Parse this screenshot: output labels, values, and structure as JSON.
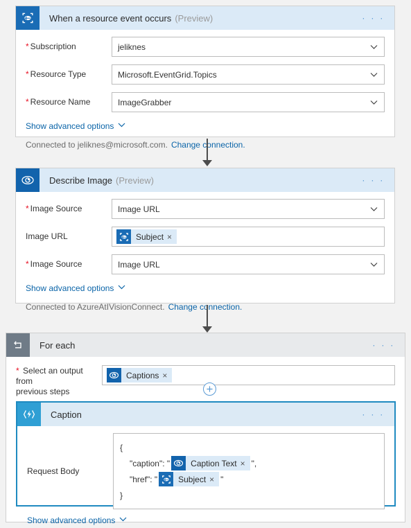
{
  "colors": {
    "accent": "#0078d4",
    "link": "#0a64a8",
    "required": "#e81123",
    "header_blue": "#dbeaf7",
    "header_gray": "#e8eaec",
    "eventgrid_icon_bg": "#1a6cb5",
    "vision_icon_bg": "#1263ac",
    "foreach_icon_bg": "#6f7b87",
    "function_icon_bg": "#2f9fd4",
    "canvas": "#f2f2f2",
    "selected_border": "#1f8ac0"
  },
  "trigger_card": {
    "title": "When a resource event occurs",
    "preview": "(Preview)",
    "icon": "event-grid-icon",
    "menu": "· · ·",
    "fields": [
      {
        "label": "Subscription",
        "required": true,
        "value": "jeliknes"
      },
      {
        "label": "Resource Type",
        "required": true,
        "value": "Microsoft.EventGrid.Topics"
      },
      {
        "label": "Resource Name",
        "required": true,
        "value": "ImageGrabber"
      }
    ],
    "advanced_label": "Show advanced options",
    "connection_text": "Connected to jeliknes@microsoft.com.",
    "change_connection_label": "Change connection."
  },
  "describe_card": {
    "title": "Describe Image",
    "preview": "(Preview)",
    "icon": "eye-icon",
    "menu": "· · ·",
    "field1": {
      "label": "Image Source",
      "required": true,
      "value": "Image URL"
    },
    "field2": {
      "label": "Image URL",
      "required": false,
      "token": {
        "label": "Subject",
        "icon": "event-grid-icon",
        "remove": "×"
      }
    },
    "field3": {
      "label": "Image Source",
      "required": true,
      "value": "Image URL"
    },
    "advanced_label": "Show advanced options",
    "connection_text": "Connected to AzureAtIVisionConnect.",
    "change_connection_label": "Change connection."
  },
  "foreach_card": {
    "title": "For each",
    "icon": "loop-icon",
    "menu": "· · ·",
    "select_label_line1": "Select an output from",
    "select_label_line2": "previous steps",
    "select_required": true,
    "token": {
      "label": "Captions",
      "icon": "eye-icon",
      "remove": "×"
    },
    "add_button": "add-step-button"
  },
  "caption_card": {
    "title": "Caption",
    "icon": "azure-function-icon",
    "menu": "· · ·",
    "request_body_label": "Request Body",
    "json_lines": [
      {
        "indent": false,
        "pre": "{",
        "token": null,
        "post": ""
      },
      {
        "indent": true,
        "pre": "\"caption\": \"",
        "token": {
          "label": "Caption Text",
          "icon": "eye-icon",
          "remove": "×"
        },
        "post": "\","
      },
      {
        "indent": true,
        "pre": "\"href\": \"",
        "token": {
          "label": "Subject",
          "icon": "event-grid-icon",
          "remove": "×"
        },
        "post": "\""
      },
      {
        "indent": false,
        "pre": "}",
        "token": null,
        "post": ""
      }
    ],
    "advanced_label": "Show advanced options"
  }
}
